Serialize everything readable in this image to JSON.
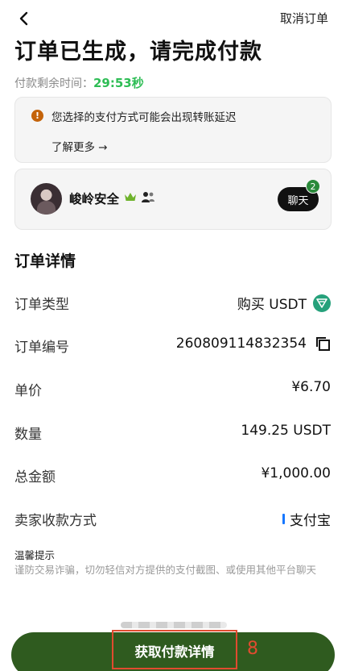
{
  "header": {
    "back_icon": "chevron-left-icon",
    "cancel_label": "取消订单"
  },
  "page": {
    "title": "订单已生成，请完成付款",
    "timer_label": "付款剩余时间：",
    "timer_value": "29:53秒"
  },
  "notice": {
    "icon": "warning-icon",
    "text": "您选择的支付方式可能会出现转账延迟",
    "learn_more": "了解更多 →"
  },
  "seller": {
    "name": "峻岭安全",
    "chat_label": "聊天",
    "unread_count": "2"
  },
  "details": {
    "title": "订单详情",
    "rows": [
      {
        "label": "订单类型",
        "value": "购买 USDT"
      },
      {
        "label": "订单编号",
        "value": "260809114832354"
      },
      {
        "label": "单价",
        "value": "¥6.70"
      },
      {
        "label": "数量",
        "value": "149.25 USDT"
      },
      {
        "label": "总金额",
        "value": "¥1,000.00"
      },
      {
        "label": "卖家收款方式",
        "value": "支付宝"
      }
    ]
  },
  "tips": {
    "title": "温馨提示",
    "body": "谨防交易诈骗，切勿轻信对方提供的支付截图、或使用其他平台聊天"
  },
  "cta": {
    "label": "获取付款详情",
    "marker": "8"
  },
  "colors": {
    "accent_green": "#2ebd55",
    "button_green": "#2f5b1f",
    "highlight_red": "#e04b2f",
    "tether_green": "#26a17b",
    "alipay_blue": "#1677ff"
  }
}
